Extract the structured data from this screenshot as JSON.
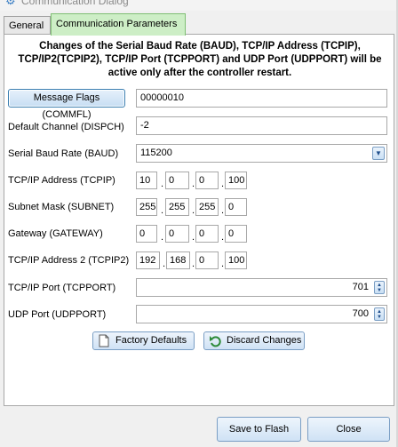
{
  "window": {
    "title": "Communication Dialog"
  },
  "tabs": [
    {
      "label": "General"
    },
    {
      "label": "Communication Parameters"
    }
  ],
  "notice": "Changes of the Serial Baud Rate (BAUD), TCP/IP Address (TCPIP), TCP/IP2(TCPIP2), TCP/IP Port (TCPPORT) and UDP Port (UDPPORT) will be active only after the controller restart.",
  "fields": {
    "message_flags": {
      "label": "Message Flags (COMMFL)",
      "value": "00000010"
    },
    "default_channel": {
      "label": "Default Channel (DISPCH)",
      "value": "-2"
    },
    "baud": {
      "label": "Serial Baud Rate (BAUD)",
      "value": "115200"
    },
    "tcpip": {
      "label": "TCP/IP Address (TCPIP)",
      "octets": [
        "10",
        "0",
        "0",
        "100"
      ]
    },
    "subnet": {
      "label": "Subnet Mask (SUBNET)",
      "octets": [
        "255",
        "255",
        "255",
        "0"
      ]
    },
    "gateway": {
      "label": "Gateway (GATEWAY)",
      "octets": [
        "0",
        "0",
        "0",
        "0"
      ]
    },
    "tcpip2": {
      "label": "TCP/IP Address 2 (TCPIP2)",
      "octets": [
        "192",
        "168",
        "0",
        "100"
      ]
    },
    "tcpport": {
      "label": "TCP/IP Port (TCPPORT)",
      "value": "701"
    },
    "udpport": {
      "label": "UDP Port (UDPPORT)",
      "value": "700"
    }
  },
  "buttons": {
    "factory_defaults": "Factory Defaults",
    "discard_changes": "Discard Changes",
    "save_to_flash": "Save to Flash",
    "close": "Close"
  },
  "icons": {
    "window": "gear-icon",
    "factory_defaults": "document-icon",
    "discard_changes": "undo-icon"
  },
  "colors": {
    "active_tab": "#cdeec6",
    "button_border": "#7a9ec4"
  }
}
